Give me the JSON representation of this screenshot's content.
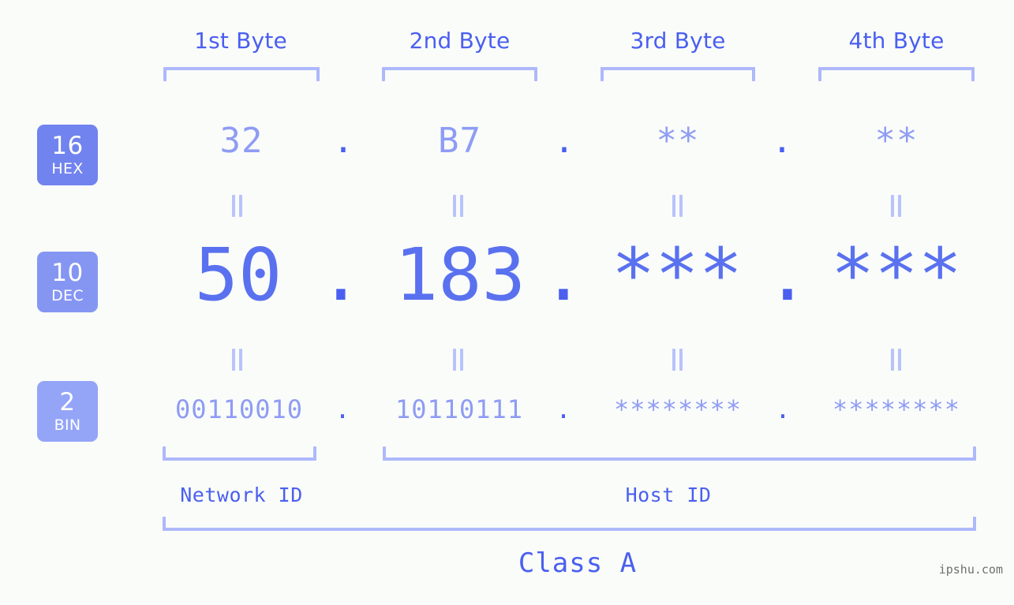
{
  "meta": {
    "background_color": "#fafcfa",
    "accent_color": "#4a5fef",
    "accent_light_color": "#8e9cf4",
    "bracket_color": "#aeb8fb",
    "watermark": "ipshu.com"
  },
  "byte_headers": [
    {
      "label": "1st Byte"
    },
    {
      "label": "2nd Byte"
    },
    {
      "label": "3rd Byte"
    },
    {
      "label": "4th Byte"
    }
  ],
  "radix_badges": [
    {
      "number": "16",
      "label": "HEX",
      "color": "#7183ee"
    },
    {
      "number": "10",
      "label": "DEC",
      "color": "#8596f2"
    },
    {
      "number": "2",
      "label": "BIN",
      "color": "#94a5f7"
    }
  ],
  "rows": {
    "hex": {
      "values": [
        "32",
        "B7",
        "**",
        "**"
      ],
      "separator": "."
    },
    "dec": {
      "values": [
        "50",
        "183",
        "***",
        "***"
      ],
      "separator": "."
    },
    "bin": {
      "values": [
        "00110010",
        "10110111",
        "********",
        "********"
      ],
      "separator": "."
    }
  },
  "equals_marks": {
    "symbol": "="
  },
  "id_sections": [
    {
      "label": "Network ID"
    },
    {
      "label": "Host ID"
    }
  ],
  "class_label": "Class A"
}
